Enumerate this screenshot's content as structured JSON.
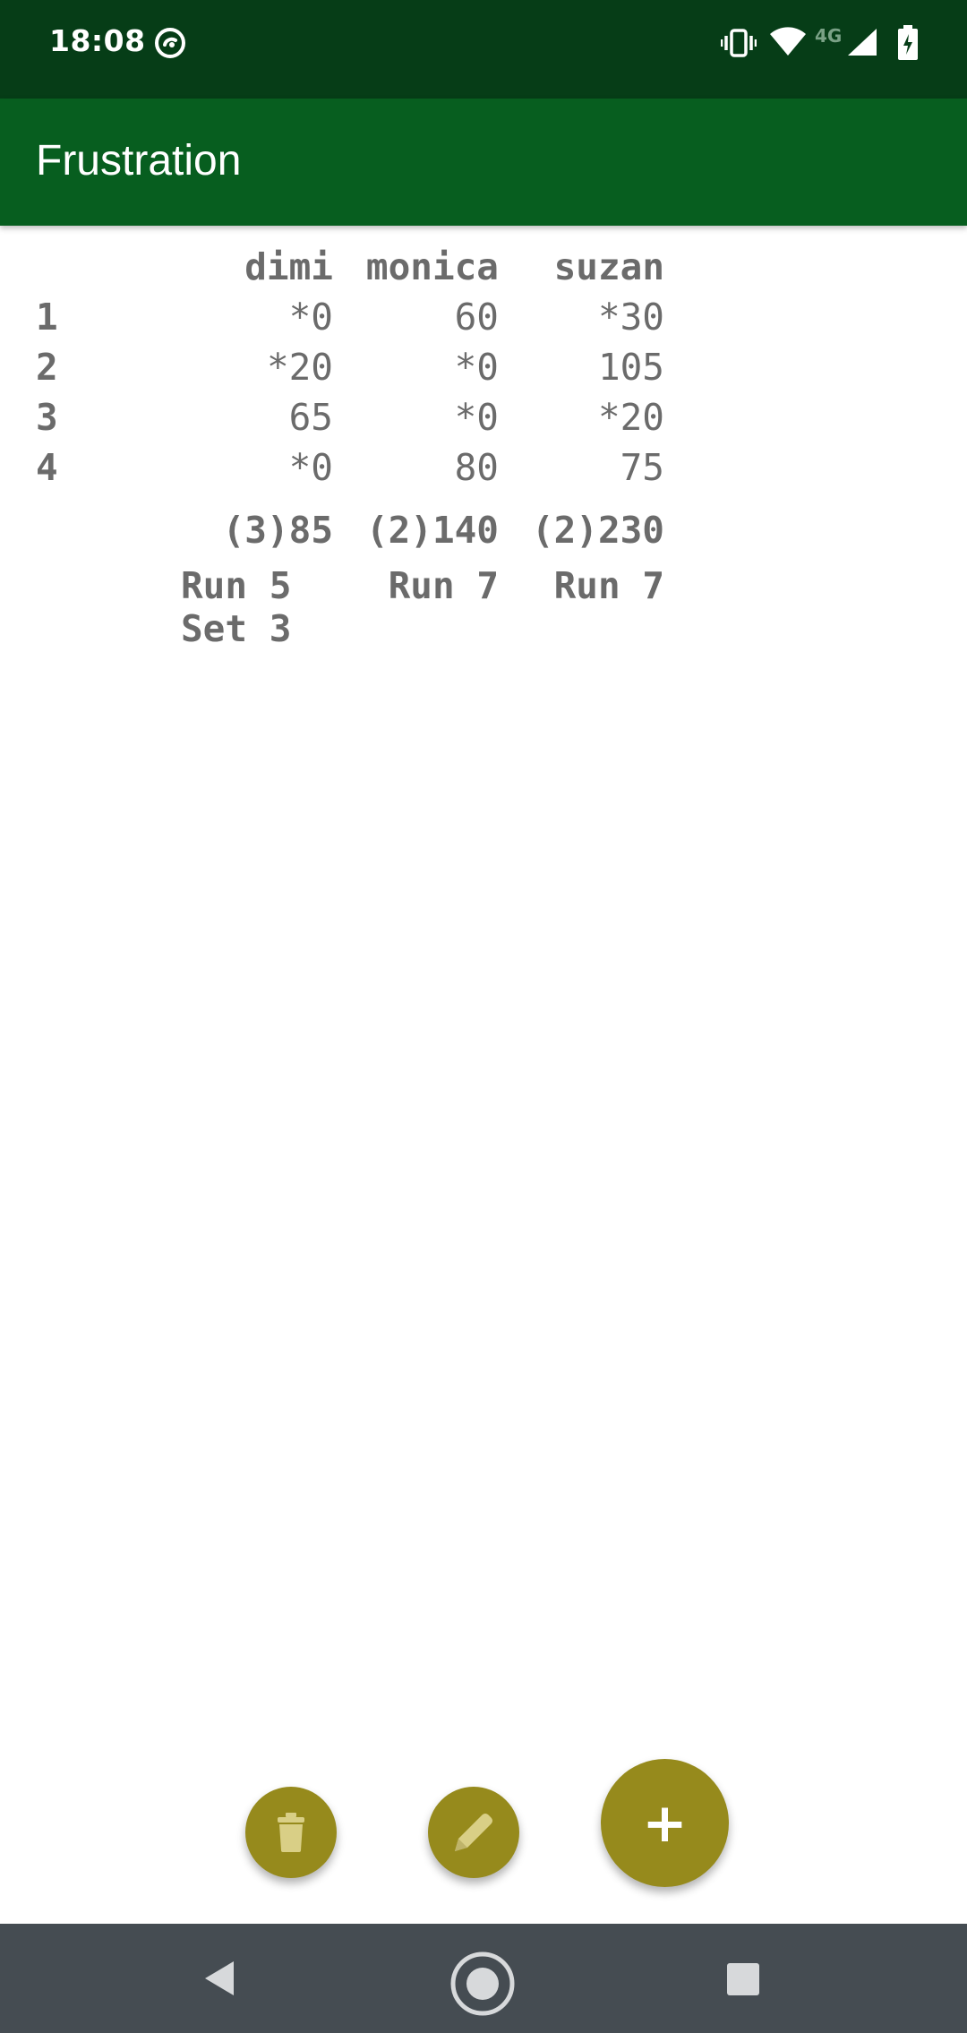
{
  "status_bar": {
    "time": "18:08",
    "network_label": "4G",
    "icons": [
      "dnd-icon",
      "vibrate-icon",
      "wifi-icon",
      "signal-icon",
      "battery-icon"
    ]
  },
  "app_bar": {
    "title": "Frustration"
  },
  "scores": {
    "players": [
      "dimi",
      "monica",
      "suzan"
    ],
    "rounds": [
      {
        "round": "1",
        "values": [
          "*0",
          "60",
          "*30"
        ]
      },
      {
        "round": "2",
        "values": [
          "*20",
          "*0",
          "105"
        ]
      },
      {
        "round": "3",
        "values": [
          "65",
          "*0",
          "*20"
        ]
      },
      {
        "round": "4",
        "values": [
          "*0",
          "80",
          "75"
        ]
      }
    ],
    "totals": [
      "(3)85",
      "(2)140",
      "(2)230"
    ],
    "status": [
      "Run 5\nSet 3",
      "Run 7",
      "Run 7"
    ]
  },
  "fabs": {
    "delete_icon": "trash-icon",
    "edit_icon": "pencil-icon",
    "add_label": "+"
  },
  "nav_bar": {
    "icons": [
      "back-icon",
      "home-icon",
      "recents-icon"
    ]
  },
  "colors": {
    "status_bar": "#063d17",
    "app_bar": "#075e1f",
    "fab": "#968a1c",
    "nav_bar": "#454c52",
    "text": "#6b6b6b"
  }
}
